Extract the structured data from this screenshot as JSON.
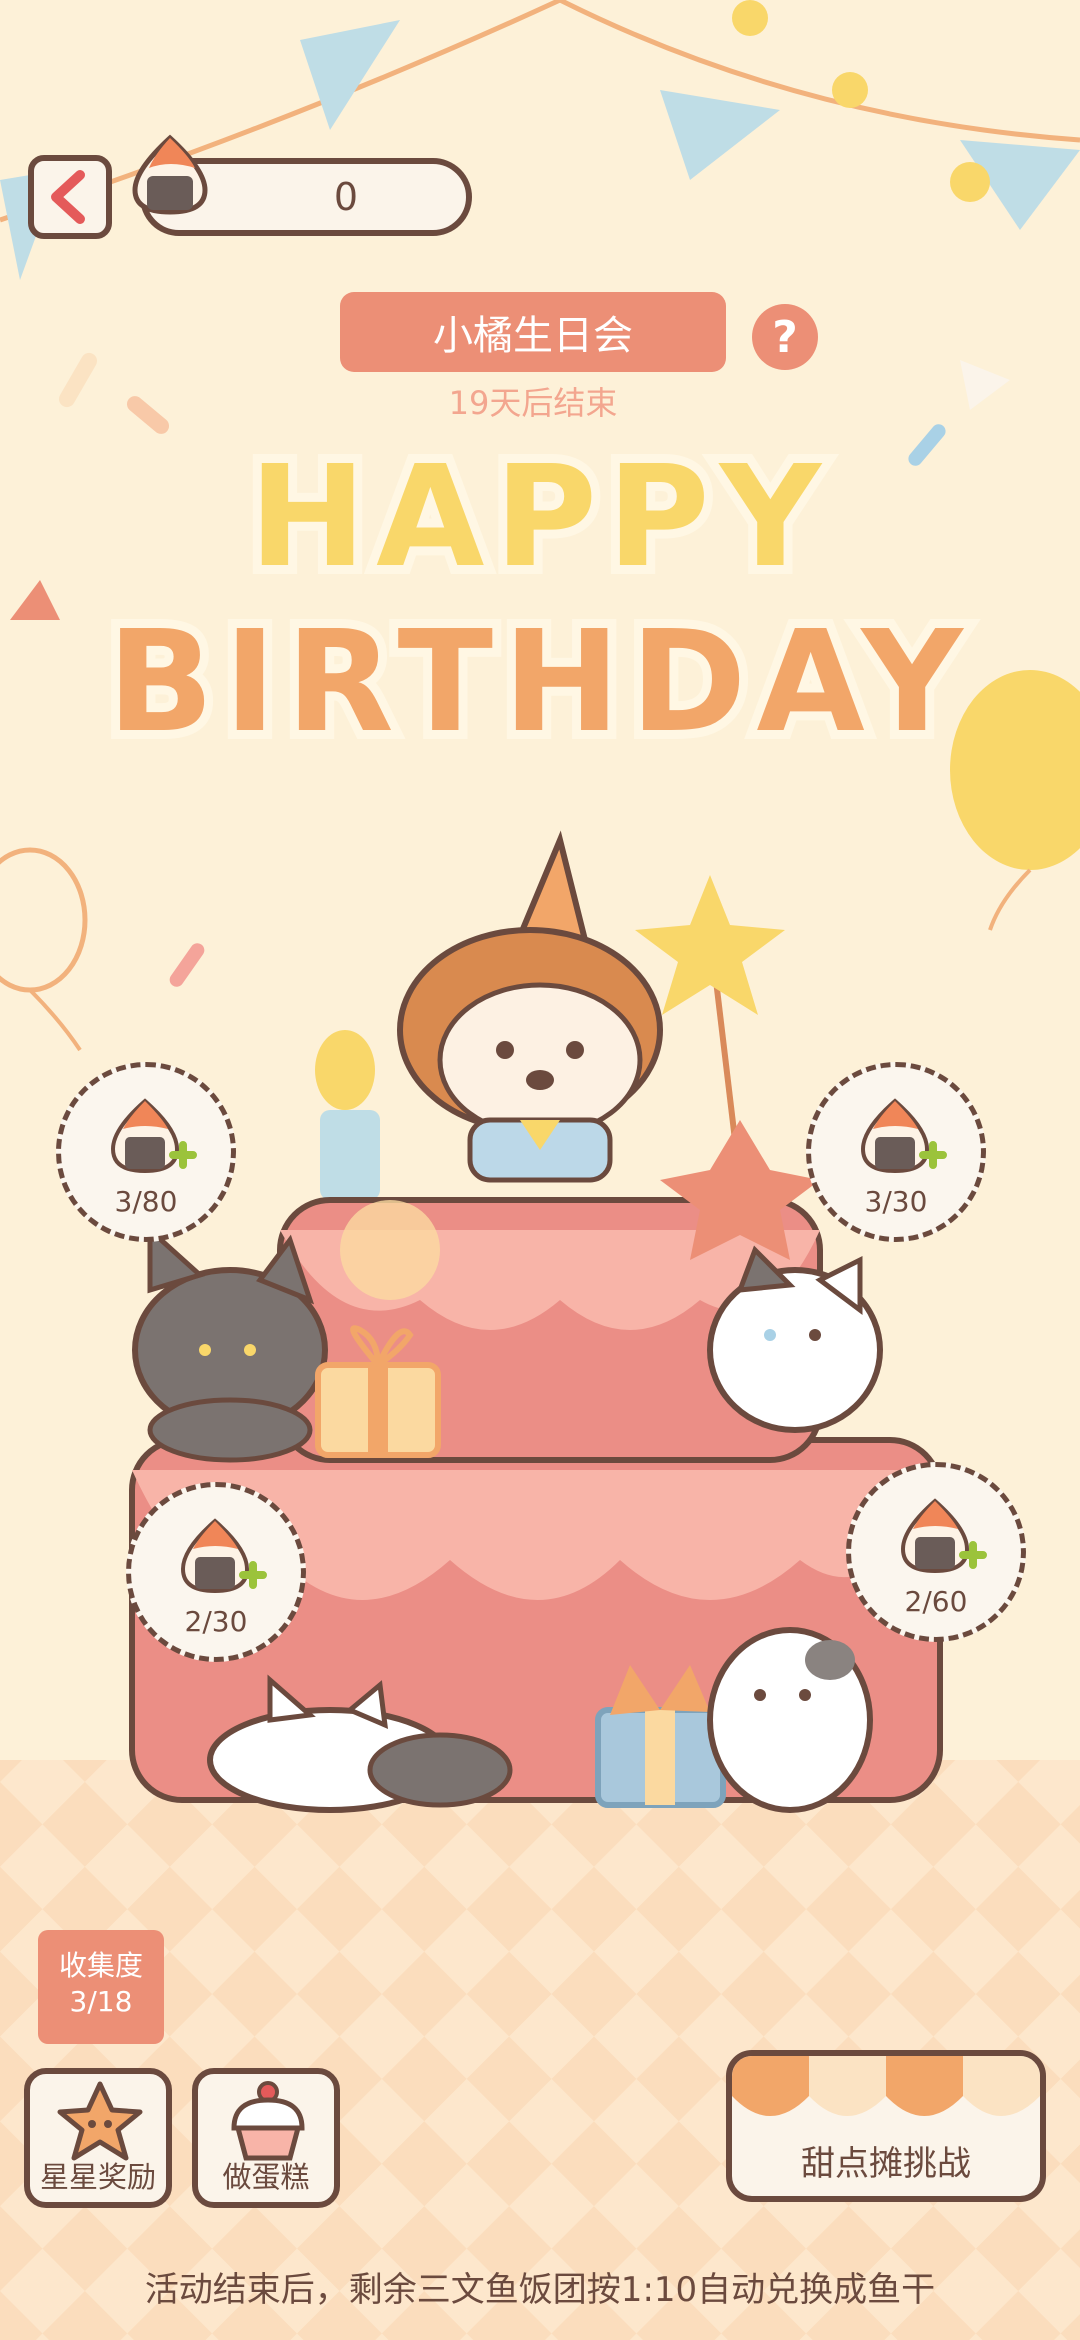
{
  "header": {
    "back_icon": "chevron-left-icon",
    "currency_icon": "salmon-onigiri-icon",
    "currency_value": "0"
  },
  "event": {
    "title": "小橘生日会",
    "countdown": "19天后结束",
    "help_icon": "question-mark-icon",
    "banner_line1": "HAPPY",
    "banner_line2": "BIRTHDAY"
  },
  "feed_spots": [
    {
      "count": "3/80"
    },
    {
      "count": "3/30"
    },
    {
      "count": "2/30"
    },
    {
      "count": "2/60"
    }
  ],
  "collection": {
    "label": "收集度",
    "value": "3/18"
  },
  "buttons": {
    "star_reward": "星星奖励",
    "make_cake": "做蛋糕",
    "dessert_stall": "甜点摊挑战"
  },
  "footer_note": "活动结束后，剩余三文鱼饭团按1:10自动兑换成鱼干",
  "colors": {
    "background": "#fdf1d8",
    "accent": "#ec8f76",
    "outline": "#6b4a3e",
    "cake_pink": "#f4a49a",
    "banner_yellow": "#f9d76a",
    "banner_orange": "#f2a669"
  }
}
